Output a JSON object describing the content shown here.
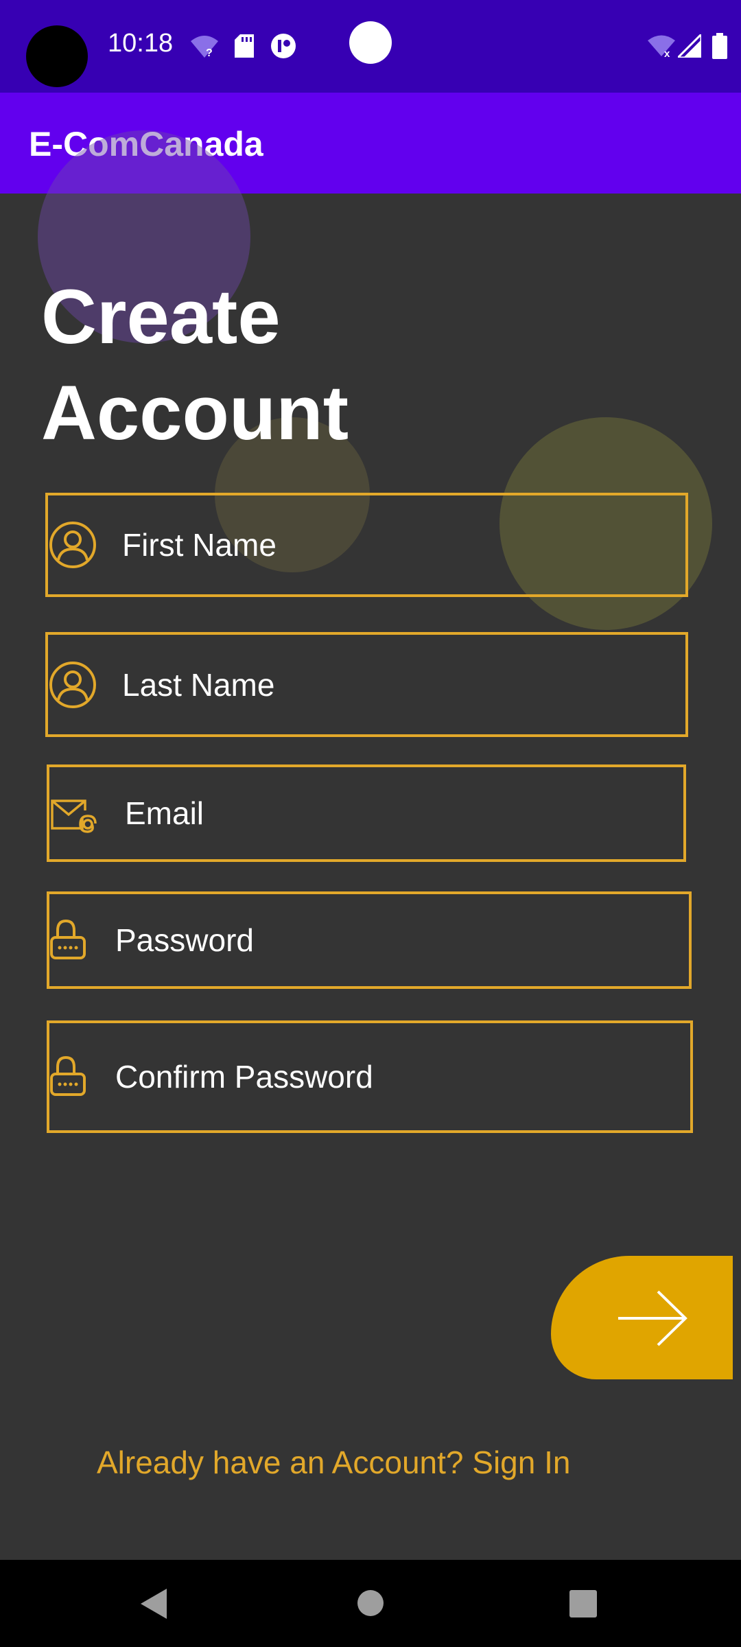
{
  "status_bar": {
    "time": "10:18",
    "icons": [
      "wifi-question-icon",
      "sd-card-icon",
      "app-notification-icon",
      "wifi-off-icon",
      "cell-signal-icon",
      "battery-icon"
    ]
  },
  "app_bar": {
    "title": "E-ComCanada"
  },
  "heading": {
    "line1": "Create",
    "line2": "Account"
  },
  "form": {
    "first_name": {
      "placeholder": "First Name",
      "value": "",
      "icon": "person-icon"
    },
    "last_name": {
      "placeholder": "Last Name",
      "value": "",
      "icon": "person-icon"
    },
    "email": {
      "placeholder": "Email",
      "value": "",
      "icon": "email-at-icon"
    },
    "password": {
      "placeholder": "Password",
      "value": "",
      "icon": "lock-icon"
    },
    "confirm_password": {
      "placeholder": "Confirm Password",
      "value": "",
      "icon": "lock-icon"
    }
  },
  "next_button": {
    "icon": "arrow-right-icon"
  },
  "signin_link": "Already have an Account? Sign In",
  "nav_bar": {
    "buttons": [
      "back-icon",
      "home-icon",
      "recents-icon"
    ]
  },
  "colors": {
    "status_bar": "#3700B3",
    "app_bar": "#6200EE",
    "background": "#343434",
    "accent": "#E2A82A",
    "button": "#E0A500"
  }
}
